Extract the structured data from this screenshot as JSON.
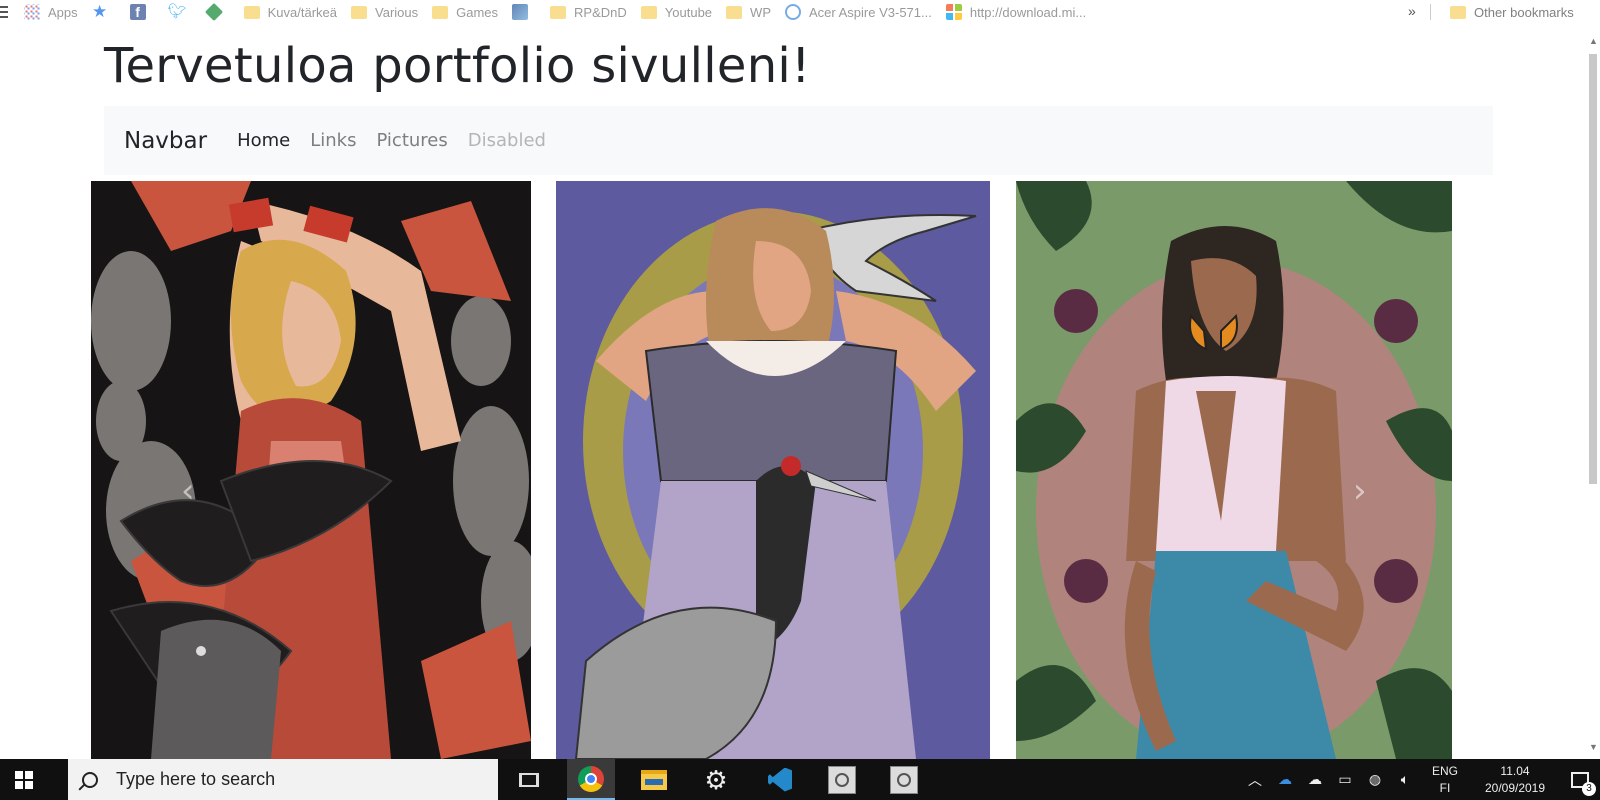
{
  "bookmarks": {
    "items": [
      {
        "label": "Apps",
        "icon": "apps-grid-icon"
      },
      {
        "label": "",
        "icon": "star-icon"
      },
      {
        "label": "",
        "icon": "facebook-icon"
      },
      {
        "label": "",
        "icon": "twitter-icon"
      },
      {
        "label": "",
        "icon": "green-diamond-icon"
      },
      {
        "label": "Kuva/tärkeä",
        "icon": "folder-icon"
      },
      {
        "label": "Various",
        "icon": "folder-icon"
      },
      {
        "label": "Games",
        "icon": "folder-icon"
      },
      {
        "label": "",
        "icon": "image-bookmark-icon"
      },
      {
        "label": "RP&DnD",
        "icon": "folder-icon"
      },
      {
        "label": "Youtube",
        "icon": "folder-icon"
      },
      {
        "label": "WP",
        "icon": "folder-icon"
      },
      {
        "label": "Acer Aspire V3-571...",
        "icon": "circle-icon"
      },
      {
        "label": "http://download.mi...",
        "icon": "microsoft-icon"
      }
    ],
    "more": "»",
    "other": "Other bookmarks"
  },
  "page": {
    "title": "Tervetuloa portfolio sivulleni!"
  },
  "navbar": {
    "brand": "Navbar",
    "links": [
      {
        "label": "Home",
        "state": "active"
      },
      {
        "label": "Links",
        "state": "normal"
      },
      {
        "label": "Pictures",
        "state": "normal"
      },
      {
        "label": "Disabled",
        "state": "disabled"
      }
    ]
  },
  "carousel": {
    "prev": "‹",
    "next": "›",
    "slides": [
      {
        "subject": "illustration-woman-with-crows"
      },
      {
        "subject": "illustration-woman-with-cranes"
      },
      {
        "subject": "illustration-woman-with-butterfly"
      }
    ]
  },
  "taskbar": {
    "search_placeholder": "Type here to search",
    "language_top": "ENG",
    "language_bottom": "FI",
    "time": "11.04",
    "date": "20/09/2019",
    "notification_count": "3"
  },
  "colors": {
    "navbar_bg": "#f8f9fa",
    "text_dark": "#212529",
    "nav_link": "#7c7f82",
    "taskbar_bg": "#101010",
    "search_bg": "#f2f2f2"
  }
}
